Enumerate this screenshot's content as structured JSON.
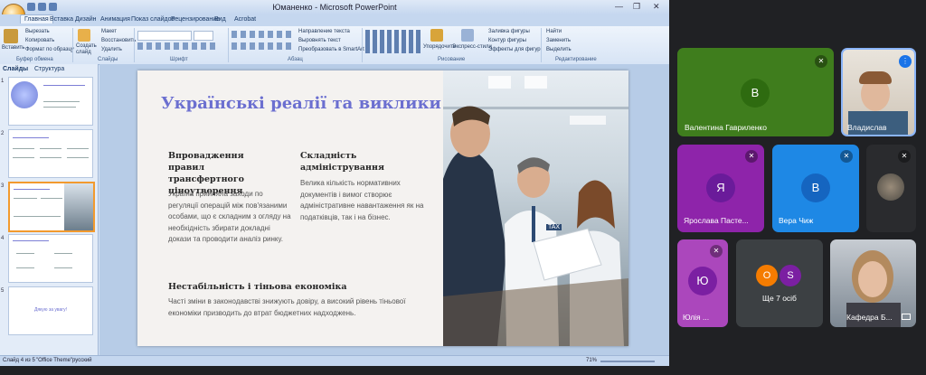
{
  "window": {
    "title": "Юманенко - Microsoft PowerPoint"
  },
  "tabs": [
    "Главная",
    "Вставка",
    "Дизайн",
    "Анимация",
    "Показ слайдов",
    "Рецензирование",
    "Вид",
    "Acrobat"
  ],
  "ribbon": {
    "paste": "Вставить",
    "cut": "Вырезать",
    "copy": "Копировать",
    "format_painter": "Формат по образцу",
    "new_slide": "Создать слайд",
    "layout": "Макет",
    "reset": "Восстановить",
    "delete": "Удалить",
    "text_direction": "Направление текста",
    "align_text": "Выровнять текст",
    "smartart": "Преобразовать в SmartArt",
    "arrange": "Упорядочить",
    "quick_styles": "Экспресс-стили",
    "shape_fill": "Заливка фигуры",
    "shape_outline": "Контур фигуры",
    "shape_effects": "Эффекты для фигур",
    "find": "Найти",
    "replace": "Заменить",
    "select": "Выделить",
    "groups": [
      "Буфер обмена",
      "Слайды",
      "Шрифт",
      "Абзац",
      "Рисование",
      "Редактирование"
    ]
  },
  "left_pane": {
    "tab_slides": "Слайды",
    "tab_outline": "Структура",
    "thumbnails": [
      {
        "num": "1"
      },
      {
        "num": "2"
      },
      {
        "num": "3"
      },
      {
        "num": "4"
      },
      {
        "num": "5",
        "text": "Дякую за увагу!"
      }
    ]
  },
  "slide": {
    "title": "Українські реалії та виклики",
    "card1": {
      "heading": "Впровадження правил трансфертного ціноутворення",
      "text": "Україна прийняла заходи по регуляції операцій між пов'язаними особами, що є складним з огляду на необхідність збирати докладні докази та проводити аналіз ринку."
    },
    "card2": {
      "heading": "Складність адміністрування",
      "text": "Велика кількість нормативних документів і вимог створює адміністративне навантаження як на податківців, так і на бізнес."
    },
    "card3": {
      "heading": "Нестабільність і тіньова економіка",
      "text": "Часті зміни в законодавстві знижують довіру, а високий рівень тіньової економіки призводить до втрат бюджетних надходжень."
    },
    "photo_tag": "TAX"
  },
  "status": {
    "slide_info": "Слайд 4 из 5",
    "theme": "\"Office Theme\"",
    "language": "русский",
    "zoom": "71%"
  },
  "participants": [
    {
      "name": "Валентина Гавриленко",
      "initial": "В",
      "color": "#3f7d1d",
      "avatar_color": "#2e6b10"
    },
    {
      "name": "Владислав"
    },
    {
      "name": "Ярослава Пасте...",
      "initial": "Я",
      "color": "#8e24aa",
      "avatar_color": "#6a1b9a"
    },
    {
      "name": "Вера Чиж",
      "initial": "В",
      "color": "#1e88e5",
      "avatar_color": "#1565c0"
    },
    {
      "name": ""
    },
    {
      "name": "Юлія ...",
      "initial": "Ю",
      "color": "#ab47bc",
      "avatar_color": "#7b1fa2"
    },
    {
      "name": "Кафедра Б..."
    }
  ],
  "others": {
    "label": "Ще 7 осіб",
    "initials": [
      "O",
      "S"
    ]
  },
  "colors": {
    "accent_title": "#6b6fd0",
    "meet_bg": "#202124",
    "tile_dark": "#3c4043"
  }
}
